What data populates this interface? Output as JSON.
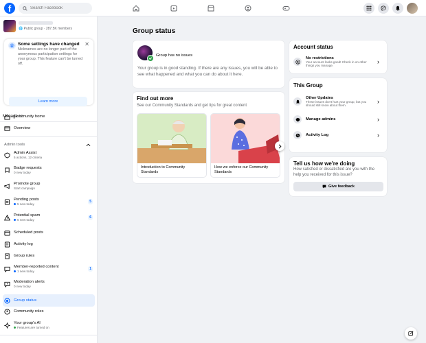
{
  "header": {
    "search_placeholder": "Search Facebook"
  },
  "group": {
    "privacy": "Public group",
    "members": "287.5K members"
  },
  "notice": {
    "title": "Some settings have changed",
    "body": "Nicknames are no longer part of the anonymous participation settings for your group. This feature can't be turned off.",
    "button": "Learn more"
  },
  "sidebar": {
    "manage_label": "Manage",
    "manage_count": "12",
    "top_items": [
      {
        "label": "Community home"
      },
      {
        "label": "Overview"
      }
    ],
    "admin_tools_label": "Admin tools",
    "admin_items": [
      {
        "label": "Admin Assist",
        "sub": "5 actions, 12 criteria"
      },
      {
        "label": "Badge requests",
        "sub": "0 new today"
      },
      {
        "label": "Promote group",
        "sub": "Start campaign"
      },
      {
        "label": "Pending posts",
        "sub": "5 new today",
        "badge": "5"
      },
      {
        "label": "Potential spam",
        "sub": "6 new today",
        "badge": "6"
      },
      {
        "label": "Scheduled posts"
      },
      {
        "label": "Activity log"
      },
      {
        "label": "Group rules"
      },
      {
        "label": "Member-reported content",
        "sub": "1 new today",
        "badge": "1"
      },
      {
        "label": "Moderation alerts",
        "sub": "0 new today"
      },
      {
        "label": "Group status"
      },
      {
        "label": "Community roles"
      },
      {
        "label": "Your group's AI",
        "sub": "Features are turned on"
      }
    ]
  },
  "main": {
    "title": "Group status",
    "status_card": {
      "label": "Group has no issues",
      "body": "Your group is in good standing. If there are any issues, you will be able to see what happened and what you can do about it here."
    },
    "find_out": {
      "title": "Find out more",
      "subtitle": "See our Community Standards and get tips for great content",
      "tiles": [
        {
          "caption": "Introduction to Community Standards"
        },
        {
          "caption": "How we enforce our Community Standards"
        }
      ]
    }
  },
  "right": {
    "account": {
      "title": "Account status",
      "row_title": "No restrictions",
      "row_sub": "Your account looks good! Check in on other things you manage."
    },
    "this_group": {
      "title": "This Group",
      "rows": [
        {
          "title": "Other Updates",
          "sub": "These issues don't hurt your group, but you should still know about them."
        },
        {
          "title": "Manage admins"
        },
        {
          "title": "Activity Log"
        }
      ]
    },
    "feedback": {
      "title": "Tell us how we're doing",
      "body": "How satisfied or dissatisfied are you with the help you received for this issue?",
      "button": "Give feedback"
    }
  },
  "colors": {
    "accent": "#0866ff",
    "success": "#31a24c"
  }
}
